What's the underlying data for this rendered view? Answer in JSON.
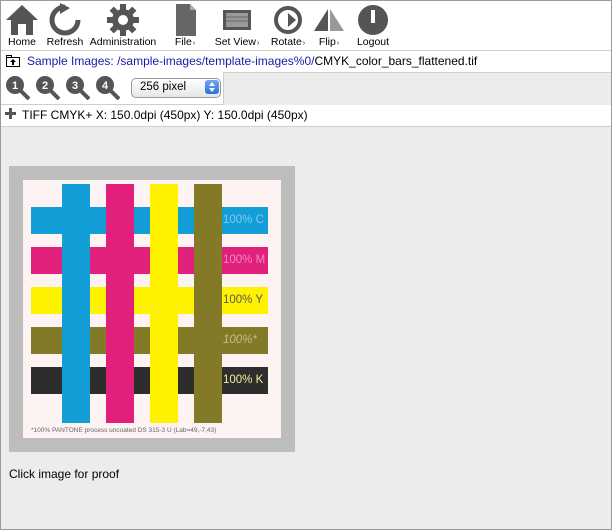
{
  "toolbar": {
    "items": [
      {
        "label": "Home",
        "icon": "home-icon",
        "dropdown": false
      },
      {
        "label": "Refresh",
        "icon": "refresh-icon",
        "dropdown": false
      },
      {
        "label": "Administration",
        "icon": "gear-icon",
        "dropdown": false
      },
      {
        "label": "File",
        "icon": "file-icon",
        "dropdown": true
      },
      {
        "label": "Set View",
        "icon": "view-icon",
        "dropdown": true
      },
      {
        "label": "Rotate",
        "icon": "rotate-icon",
        "dropdown": true
      },
      {
        "label": "Flip",
        "icon": "flip-icon",
        "dropdown": true
      },
      {
        "label": "Logout",
        "icon": "logout-icon",
        "dropdown": false
      }
    ],
    "dropdown_marker": "›"
  },
  "path": {
    "root_link": "Sample Images:",
    "folder_link": "/sample-images/template-images%0/",
    "filename": "CMYK_color_bars_flattened.tif"
  },
  "zoom": {
    "levels": [
      "1",
      "2",
      "3",
      "4"
    ],
    "selected": "256 pixel"
  },
  "info": {
    "format": "TIFF CMYK+",
    "resolution": "X: 150.0dpi (450px) Y: 150.0dpi (450px)"
  },
  "image": {
    "bar_labels": [
      "100% C",
      "100% M",
      "100% Y",
      "100%*",
      "100% K"
    ],
    "footnote": "*100% PANTONE process uncoated DS 315-3 U (Lab=49,-7,43)",
    "colors": {
      "cyan": "#139ed8",
      "magenta": "#e0207a",
      "yellow": "#fff200",
      "olive": "#827a26",
      "black": "#2d2d2d"
    }
  },
  "caption": "Click image for proof"
}
